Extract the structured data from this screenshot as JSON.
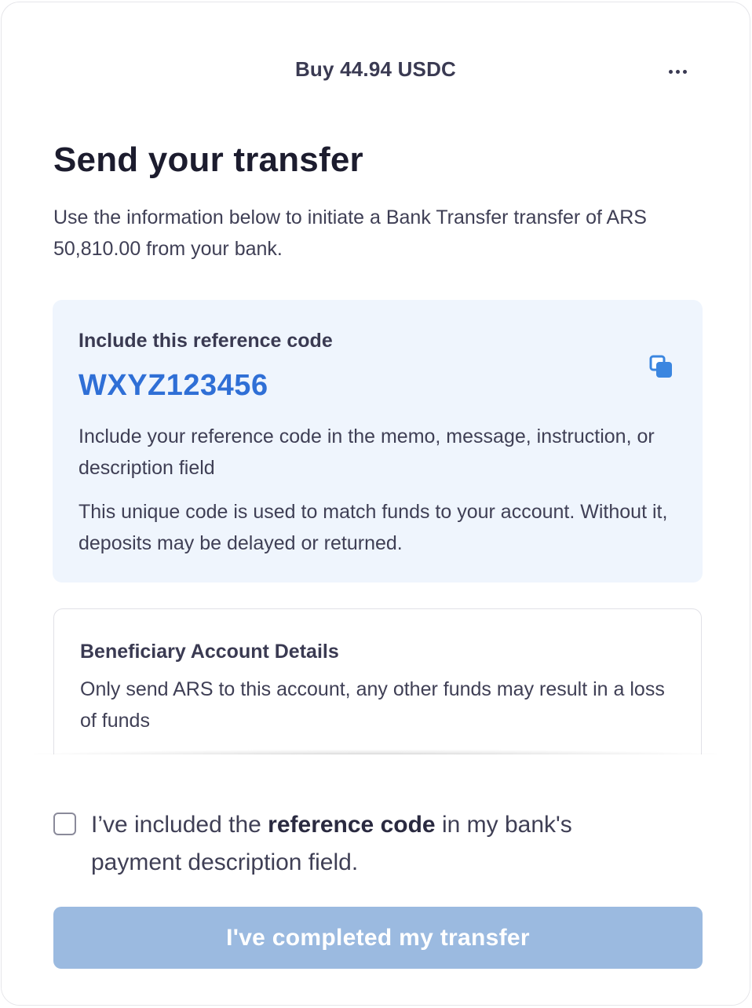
{
  "header": {
    "title": "Buy 44.94 USDC",
    "more_icon": "more-horizontal-icon"
  },
  "main": {
    "title": "Send your transfer",
    "intro": "Use the information below to initiate a Bank Transfer transfer of ARS 50,810.00 from your bank."
  },
  "reference": {
    "heading": "Include this reference code",
    "code": "WXYZ123456",
    "copy_icon": "copy-icon",
    "instruction": "Include your reference code in the memo, message, instruction, or description field",
    "note": "This unique code is used to match funds to your account. Without it, deposits may be delayed or returned."
  },
  "beneficiary": {
    "heading": "Beneficiary Account Details",
    "warning": "Only send ARS to this account, any other funds may result in a loss of funds"
  },
  "footer": {
    "checkbox_checked": false,
    "checkbox_label_prefix": "I’ve included the ",
    "checkbox_label_bold": "reference code",
    "checkbox_label_suffix": " in my bank's payment description field.",
    "submit_label": "I've completed my transfer",
    "submit_enabled": false
  },
  "colors": {
    "accent": "#2f6fd6",
    "reference_bg": "#eff5fd",
    "button_disabled": "#9bbae0"
  }
}
